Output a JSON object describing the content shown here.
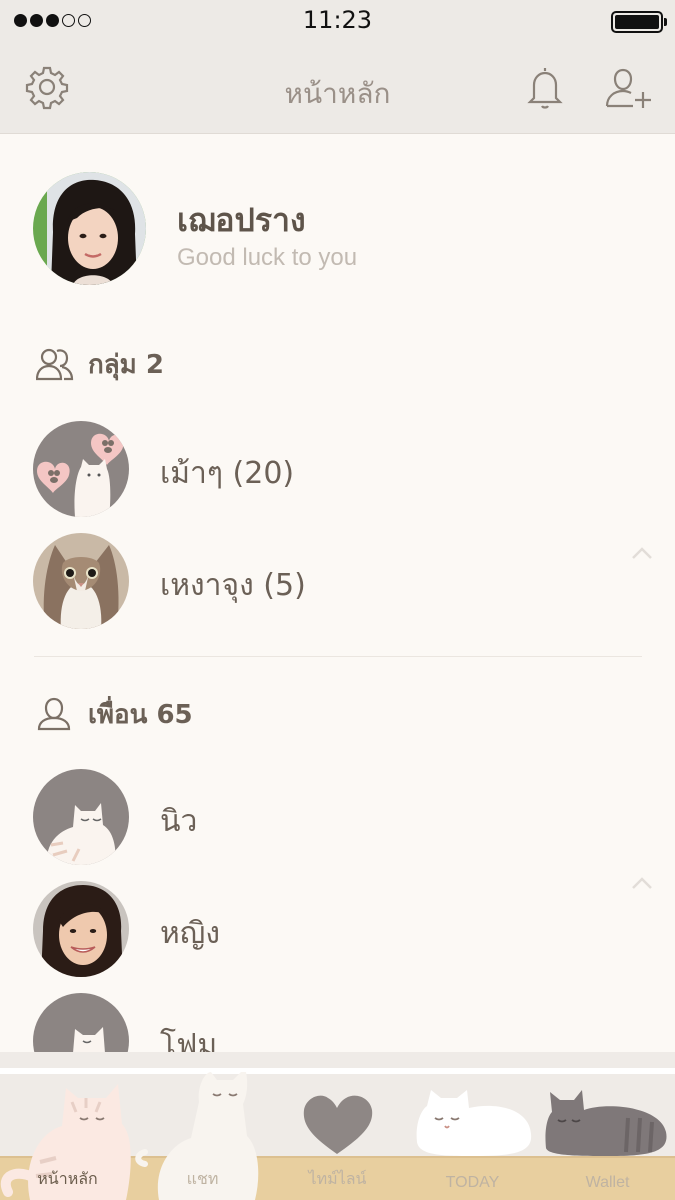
{
  "status_bar": {
    "time": "11:23",
    "signal_bars_filled": 3,
    "signal_bars_total": 5,
    "battery_level": 1.0
  },
  "nav": {
    "title": "หน้าหลัก"
  },
  "profile": {
    "name": "เฌอปราง",
    "status_message": "Good luck to you"
  },
  "groups": {
    "header": "กลุ่ม 2",
    "items": [
      {
        "name": "เม้าๆ (20)"
      },
      {
        "name": "เหงาจุง (5)"
      }
    ]
  },
  "friends": {
    "header": "เพื่อน 65",
    "items": [
      {
        "name": "นิว"
      },
      {
        "name": "หญิง"
      },
      {
        "name": "โฟม"
      }
    ]
  },
  "tabs": [
    {
      "label": "หน้าหลัก",
      "active": true
    },
    {
      "label": "แชท",
      "active": false
    },
    {
      "label": "ไทม์ไลน์",
      "active": false
    },
    {
      "label": "TODAY",
      "active": false
    },
    {
      "label": "Wallet",
      "active": false
    }
  ],
  "colors": {
    "background": "#fcf9f5",
    "bar": "#edeae6",
    "text": "#6b6056",
    "muted": "#c2bab2",
    "avatar_gray": "#8c8583",
    "shelf": "#e8cf9f"
  }
}
